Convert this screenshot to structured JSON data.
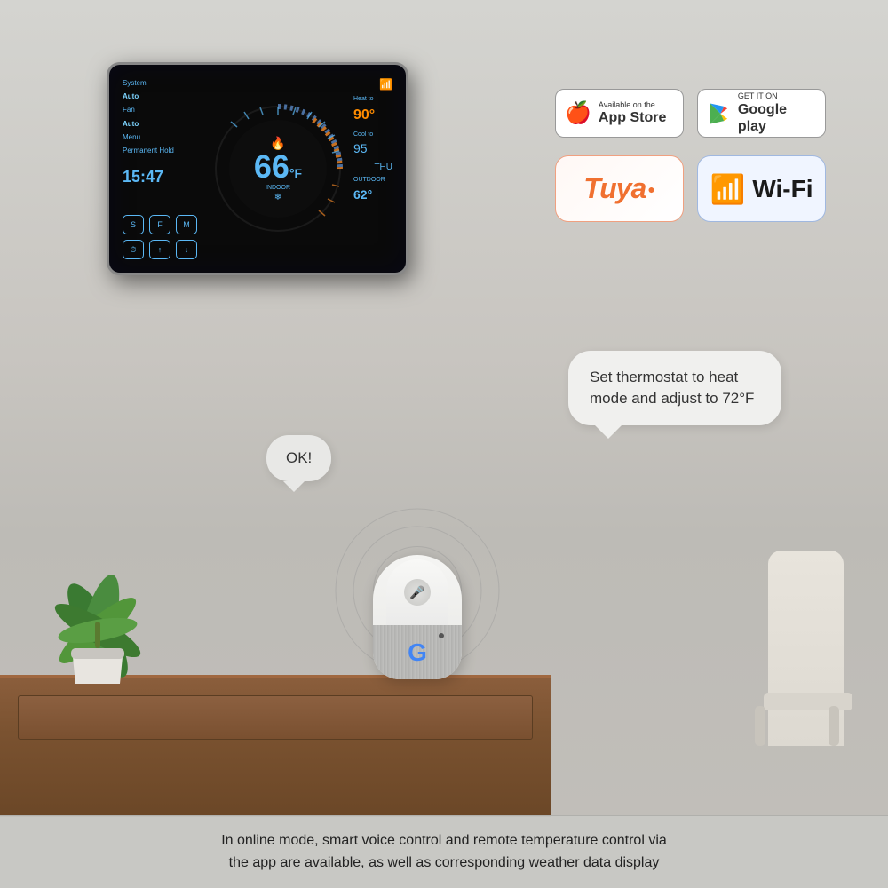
{
  "page": {
    "background_color": "#c8c8c4"
  },
  "thermostat": {
    "menu_items": [
      "System",
      "Auto",
      "Fan",
      "Auto",
      "Menu",
      "Permanent Hold"
    ],
    "time": "15:47",
    "temperature": "66",
    "temp_unit": "°F",
    "indoor_label": "INDOOR",
    "heat_to_label": "Heat to",
    "heat_temp": "90°",
    "cool_to_label": "Cool to",
    "cool_temp": "95",
    "outdoor_label": "OUTDOOR",
    "outdoor_temp": "62°",
    "day": "THU",
    "buttons": [
      "S",
      "F",
      "M",
      "⏰",
      "↑",
      "↓"
    ]
  },
  "app_store_badge": {
    "sub_text": "Available on the",
    "main_text": "App Store"
  },
  "google_play_badge": {
    "sub_text": "GET IT ON",
    "main_text": "Google play"
  },
  "tuya": {
    "brand": "Tuya"
  },
  "wifi": {
    "label": "Wi-Fi"
  },
  "speech_bubbles": {
    "command": "Set thermostat to heat\nmode and adjust to 72°F",
    "response": "OK!"
  },
  "bottom_caption": {
    "line1": "In online mode, smart voice control and remote temperature control via",
    "line2": "the app are available, as well as corresponding weather data display"
  },
  "speaker": {
    "g_label": "G"
  }
}
